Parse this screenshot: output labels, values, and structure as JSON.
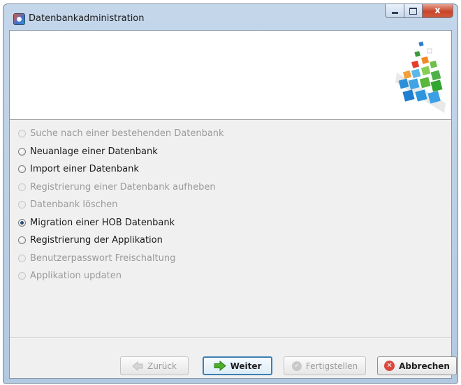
{
  "window": {
    "title": "Datenbankadministration",
    "close_glyph": "x"
  },
  "options": [
    {
      "label": "Suche nach einer bestehenden Datenbank",
      "enabled": false,
      "selected": false
    },
    {
      "label": "Neuanlage einer Datenbank",
      "enabled": true,
      "selected": false
    },
    {
      "label": "Import einer Datenbank",
      "enabled": true,
      "selected": false
    },
    {
      "label": "Registrierung einer Datenbank aufheben",
      "enabled": false,
      "selected": false
    },
    {
      "label": "Datenbank löschen",
      "enabled": false,
      "selected": false
    },
    {
      "label": "Migration einer HOB Datenbank",
      "enabled": true,
      "selected": true
    },
    {
      "label": "Registrierung der Applikation",
      "enabled": true,
      "selected": false
    },
    {
      "label": "Benutzerpasswort Freischaltung",
      "enabled": false,
      "selected": false
    },
    {
      "label": "Applikation updaten",
      "enabled": false,
      "selected": false
    }
  ],
  "buttons": {
    "back": {
      "label": "Zurück",
      "enabled": false,
      "icon": "back-arrow-icon"
    },
    "next": {
      "label": "Weiter",
      "enabled": true,
      "icon": "forward-arrow-icon"
    },
    "finish": {
      "label": "Fertigstellen",
      "enabled": false,
      "icon": "check-icon"
    },
    "cancel": {
      "label": "Abbrechen",
      "enabled": true,
      "icon": "cancel-icon"
    }
  },
  "colors": {
    "accent": "#3c7fb1",
    "cancel_red": "#d9483b",
    "next_arrow": "#4caf2a",
    "disabled_text": "#9a9a9a"
  }
}
